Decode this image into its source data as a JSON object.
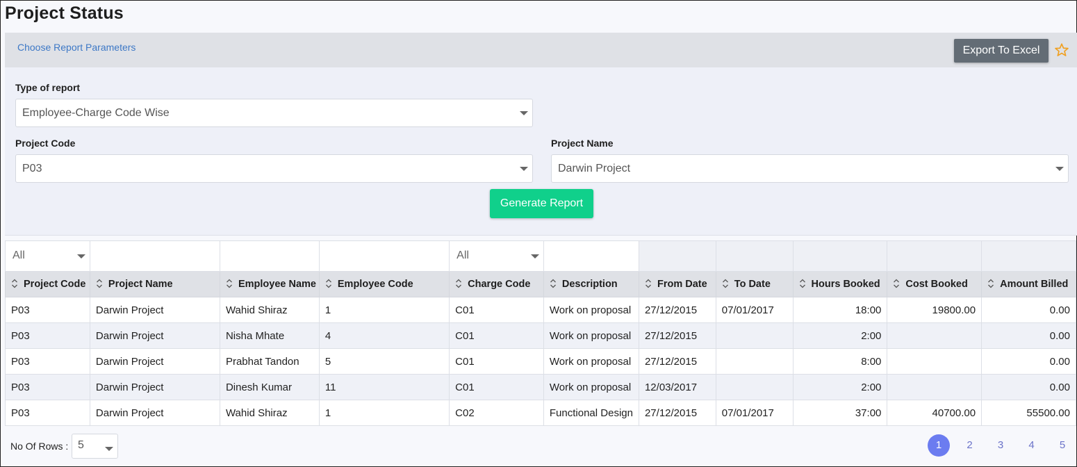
{
  "page": {
    "title": "Project Status"
  },
  "params_bar": {
    "link": "Choose Report Parameters",
    "export_label": "Export To Excel",
    "star_icon": "star-outline-icon",
    "star_color": "#f0a020"
  },
  "form": {
    "type_label": "Type of report",
    "type_value": "Employee-Charge Code Wise",
    "project_code_label": "Project Code",
    "project_code_value": "P03",
    "project_name_label": "Project Name",
    "project_name_value": "Darwin Project",
    "generate_label": "Generate Report",
    "generate_color": "#10d08b"
  },
  "grid": {
    "filters": {
      "project_code": "All",
      "charge_code": "All"
    },
    "columns": [
      "Project Code",
      "Project Name",
      "Employee Name",
      "Employee Code",
      "Charge Code",
      "Description",
      "From Date",
      "To Date",
      "Hours Booked",
      "Cost Booked",
      "Amount Billed"
    ],
    "rows": [
      [
        "P03",
        "Darwin Project",
        "Wahid Shiraz",
        "1",
        "C01",
        "Work on proposal",
        "27/12/2015",
        "07/01/2017",
        "18:00",
        "19800.00",
        "0.00"
      ],
      [
        "P03",
        "Darwin Project",
        "Nisha Mhate",
        "4",
        "C01",
        "Work on proposal",
        "27/12/2015",
        "",
        "2:00",
        "",
        "0.00"
      ],
      [
        "P03",
        "Darwin Project",
        "Prabhat Tandon",
        "5",
        "C01",
        "Work on proposal",
        "27/12/2015",
        "",
        "8:00",
        "",
        "0.00"
      ],
      [
        "P03",
        "Darwin Project",
        "Dinesh Kumar",
        "11",
        "C01",
        "Work on proposal",
        "12/03/2017",
        "",
        "2:00",
        "",
        "0.00"
      ],
      [
        "P03",
        "Darwin Project",
        "Wahid Shiraz",
        "1",
        "C02",
        "Functional Design",
        "27/12/2015",
        "07/01/2017",
        "37:00",
        "40700.00",
        "55500.00"
      ]
    ]
  },
  "footer": {
    "rows_label": "No Of Rows :",
    "rows_value": "5",
    "pages": [
      "1",
      "2",
      "3",
      "4",
      "5"
    ],
    "active_page": "1",
    "active_color": "#6b7cf0"
  }
}
